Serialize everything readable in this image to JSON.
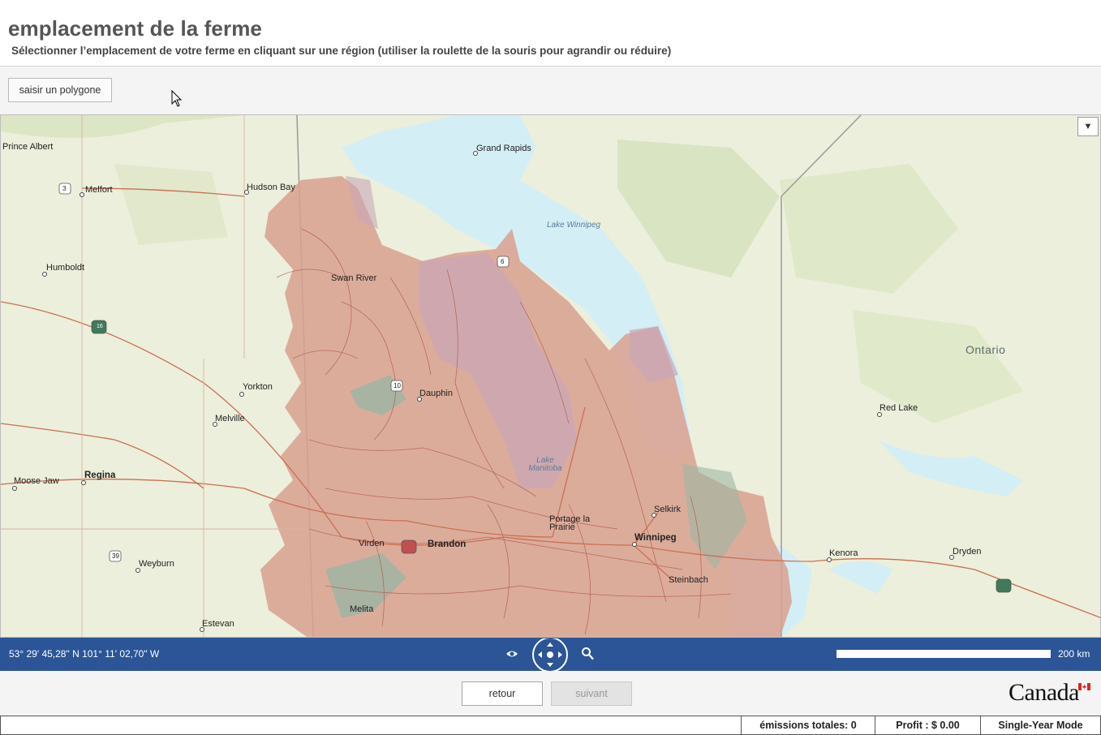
{
  "header": {
    "title": "emplacement de la ferme",
    "subtitle": "Sélectionner l’emplacement de votre ferme en cliquant sur une région (utiliser la roulette de la souris pour agrandir ou réduire)"
  },
  "toolbar": {
    "polygon_button": "saisir un polygone"
  },
  "map": {
    "dropdown_glyph": "▼",
    "places": [
      {
        "name": "Prince Albert",
        "style": "normal"
      },
      {
        "name": "Melfort",
        "style": "normal"
      },
      {
        "name": "Hudson Bay",
        "style": "normal"
      },
      {
        "name": "Grand Rapids",
        "style": "normal"
      },
      {
        "name": "Humboldt",
        "style": "normal"
      },
      {
        "name": "Swan River",
        "style": "normal"
      },
      {
        "name": "Yorkton",
        "style": "normal"
      },
      {
        "name": "Dauphin",
        "style": "normal"
      },
      {
        "name": "Melville",
        "style": "normal"
      },
      {
        "name": "Moose Jaw",
        "style": "normal"
      },
      {
        "name": "Regina",
        "style": "big"
      },
      {
        "name": "Virden",
        "style": "normal"
      },
      {
        "name": "Brandon",
        "style": "big"
      },
      {
        "name": "Portage la Prairie",
        "style": "normal"
      },
      {
        "name": "Winnipeg",
        "style": "big"
      },
      {
        "name": "Selkirk",
        "style": "normal"
      },
      {
        "name": "Steinbach",
        "style": "normal"
      },
      {
        "name": "Weyburn",
        "style": "normal"
      },
      {
        "name": "Estevan",
        "style": "normal"
      },
      {
        "name": "Melita",
        "style": "normal"
      },
      {
        "name": "Red Lake",
        "style": "normal"
      },
      {
        "name": "Kenora",
        "style": "normal"
      },
      {
        "name": "Dryden",
        "style": "normal"
      }
    ],
    "water_labels": [
      "Lake Winnipeg",
      "Lake Manitoba"
    ],
    "province_label": "Ontario",
    "highway_shields": [
      "3",
      "16",
      "10",
      "6",
      "39"
    ]
  },
  "statusbar": {
    "coordinates": "53° 29' 45,28\" N 101° 11' 02,70\" W",
    "scale_label": "200 km"
  },
  "navigation": {
    "back_label": "retour",
    "next_label": "suivant",
    "canada_wordmark": "Canada"
  },
  "footer": {
    "emissions": "émissions totales: 0",
    "profit": "Profit :  $ 0.00",
    "mode": "Single-Year Mode"
  },
  "colors": {
    "statusbar": "#2b5597",
    "soil_polygon": "#d9a08f",
    "soil_outline": "#b05a4a",
    "water": "#d4eef6",
    "land": "#ecefdb"
  }
}
